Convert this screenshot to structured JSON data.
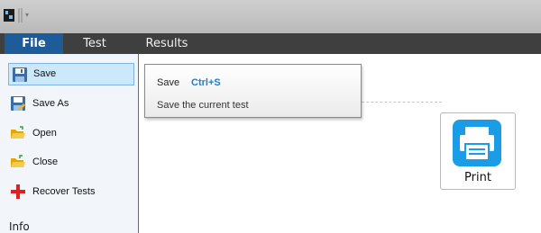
{
  "titlebar": {
    "app_icon": "app-icon",
    "quick_access_dropdown": "▾"
  },
  "menubar": {
    "tabs": [
      {
        "label": "File",
        "active": true
      },
      {
        "label": "Test",
        "active": false
      },
      {
        "label": "Results",
        "active": false
      }
    ]
  },
  "sidebar": {
    "items": [
      {
        "label": "Save",
        "icon": "floppy-disk-icon",
        "active": true
      },
      {
        "label": "Save As",
        "icon": "floppy-disk-edit-icon",
        "active": false
      },
      {
        "label": "Open",
        "icon": "folder-open-icon",
        "active": false
      },
      {
        "label": "Close",
        "icon": "folder-close-icon",
        "active": false
      },
      {
        "label": "Recover Tests",
        "icon": "plus-icon",
        "active": false
      }
    ],
    "section_header": "Info"
  },
  "tooltip": {
    "title": "Save",
    "shortcut": "Ctrl+S",
    "description": "Save the current test"
  },
  "main": {
    "print_button": {
      "label": "Print",
      "icon": "printer-icon"
    }
  },
  "colors": {
    "menubar_bg": "#3f3f3f",
    "active_tab": "#1d5c98",
    "sidebar_active": "#cce8fb",
    "shortcut_text": "#1f7fd0",
    "print_icon": "#1a9de6"
  }
}
